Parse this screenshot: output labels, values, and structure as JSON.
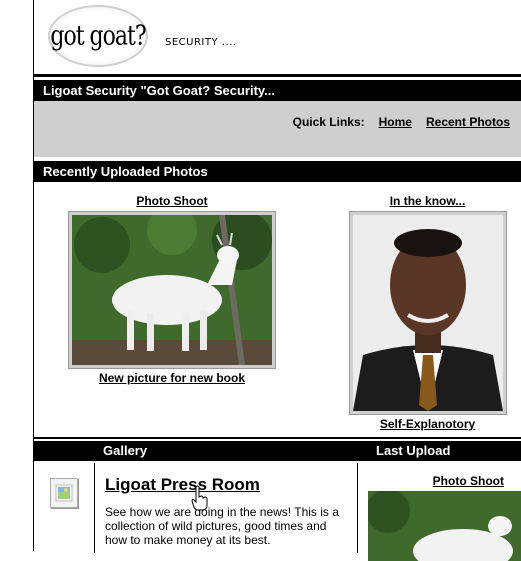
{
  "header": {
    "logo_text": "got goat?",
    "tagline": "SECURITY ...."
  },
  "title_bar": {
    "title": "Ligoat Security \"Got Goat? Security..."
  },
  "quick_links": {
    "label": "Quick Links:",
    "items": [
      {
        "label": "Home"
      },
      {
        "label": "Recent Photos"
      }
    ]
  },
  "recent": {
    "heading": "Recently Uploaded Photos",
    "photos": [
      {
        "title": "Photo Shoot",
        "caption": "New picture for new book",
        "icon": "goat-photo"
      },
      {
        "title": "In the know...",
        "caption": "Self-Explanotory",
        "icon": "portrait-photo"
      }
    ]
  },
  "gallery_bar": {
    "gallery": "Gallery",
    "last_upload": "Last Upload"
  },
  "gallery": {
    "icon": "gallery-thumbnail-icon",
    "title": "Ligoat Press Room",
    "description": "See how we are doing in the news! This is a collection of wild pictures, good times and how to make money at its best."
  },
  "last_upload": {
    "title": "Photo Shoot"
  }
}
